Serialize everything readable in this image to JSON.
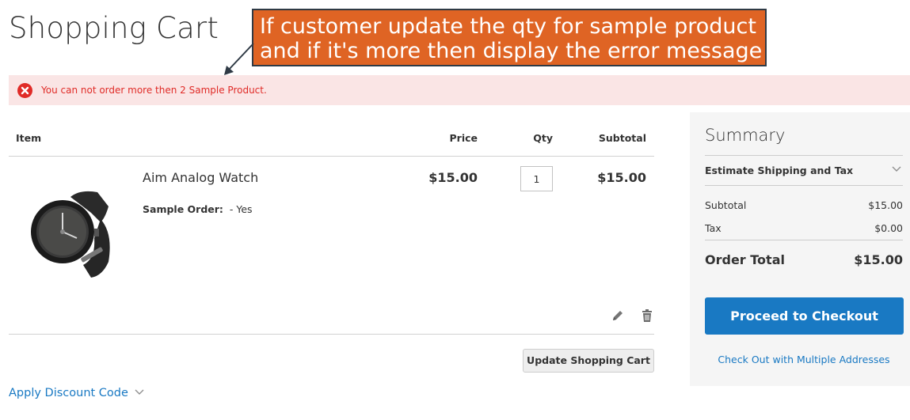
{
  "page": {
    "title": "Shopping Cart"
  },
  "annotation": {
    "line1": "If customer update the qty for sample product",
    "line2": "and if it's more then display the error message",
    "color": "#df6424"
  },
  "error": {
    "icon": "error-x-icon",
    "message": "You can not order more then 2 Sample Product.",
    "color": "#e02b27"
  },
  "cart": {
    "headers": {
      "item": "Item",
      "price": "Price",
      "qty": "Qty",
      "subtotal": "Subtotal"
    },
    "items": [
      {
        "name": "Aim Analog Watch",
        "image": "wristwatch-image",
        "option_label": "Sample Order:",
        "option_value": "- Yes",
        "price": "$15.00",
        "qty": "1",
        "subtotal": "$15.00",
        "actions": [
          "pencil-edit-icon",
          "trash-icon"
        ]
      }
    ],
    "update_button": "Update Shopping Cart"
  },
  "discount": {
    "label": "Apply Discount Code",
    "icon": "chevron-down-icon"
  },
  "summary": {
    "title": "Summary",
    "estimate_label": "Estimate Shipping and Tax",
    "subtotal_label": "Subtotal",
    "subtotal_value": "$15.00",
    "tax_label": "Tax",
    "tax_value": "$0.00",
    "total_label": "Order Total",
    "total_value": "$15.00",
    "checkout_button": "Proceed to Checkout",
    "multi_address_link": "Check Out with Multiple Addresses"
  },
  "colors": {
    "primary_blue": "#1979c3",
    "summary_bg": "#f5f5f5",
    "error_bg": "#fae5e5"
  }
}
